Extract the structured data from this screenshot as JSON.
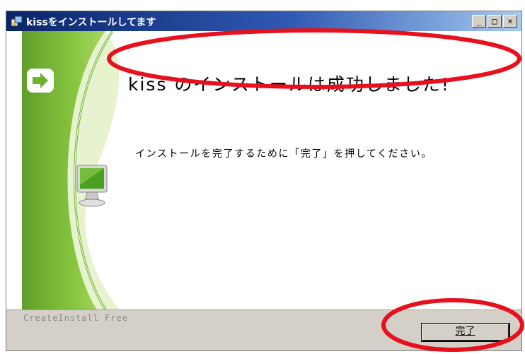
{
  "window": {
    "title": "kissをインストールしてます"
  },
  "title_buttons": {
    "minimize": "_",
    "maximize": "□",
    "close": "×"
  },
  "content": {
    "headline": "kiss のインストールは成功しました!",
    "instruction": "インストールを完了するために「完了」を押してください。"
  },
  "footer": {
    "brand": "CreateInstall Free",
    "finish_label": "完了"
  },
  "colors": {
    "titlebar_start": "#0a246a",
    "titlebar_end": "#a6caf0",
    "accent_green": "#7cc23c",
    "highlight_red": "#e8101c",
    "dialog_gray": "#d4d0c8"
  },
  "icons": [
    "installer-icon",
    "arrow-right-icon",
    "monitor-icon"
  ]
}
